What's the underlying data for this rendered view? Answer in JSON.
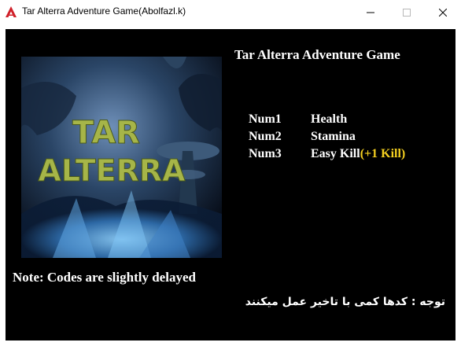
{
  "window": {
    "title": "Tar Alterra Adventure Game(Abolfazl.k)",
    "controls": [
      "minimize",
      "maximize",
      "close"
    ]
  },
  "colors": {
    "background": "#000000",
    "text": "#ffffff",
    "highlight": "#f5d020",
    "app_icon": "#d0202a"
  },
  "cover_art": {
    "logo_line1": "TAR",
    "logo_line2": "ALTERRA"
  },
  "main": {
    "title": "Tar Alterra Adventure Game",
    "hotkeys": [
      {
        "key": "Num1",
        "action": "Health",
        "extra": ""
      },
      {
        "key": "Num2",
        "action": "Stamina",
        "extra": ""
      },
      {
        "key": "Num3",
        "action": "Easy Kill",
        "extra": "(+1 Kill)"
      }
    ],
    "note_en": "Note: Codes are slightly delayed",
    "note_fa": "توجه : کدها کمی با تاخیر عمل میکنند"
  }
}
